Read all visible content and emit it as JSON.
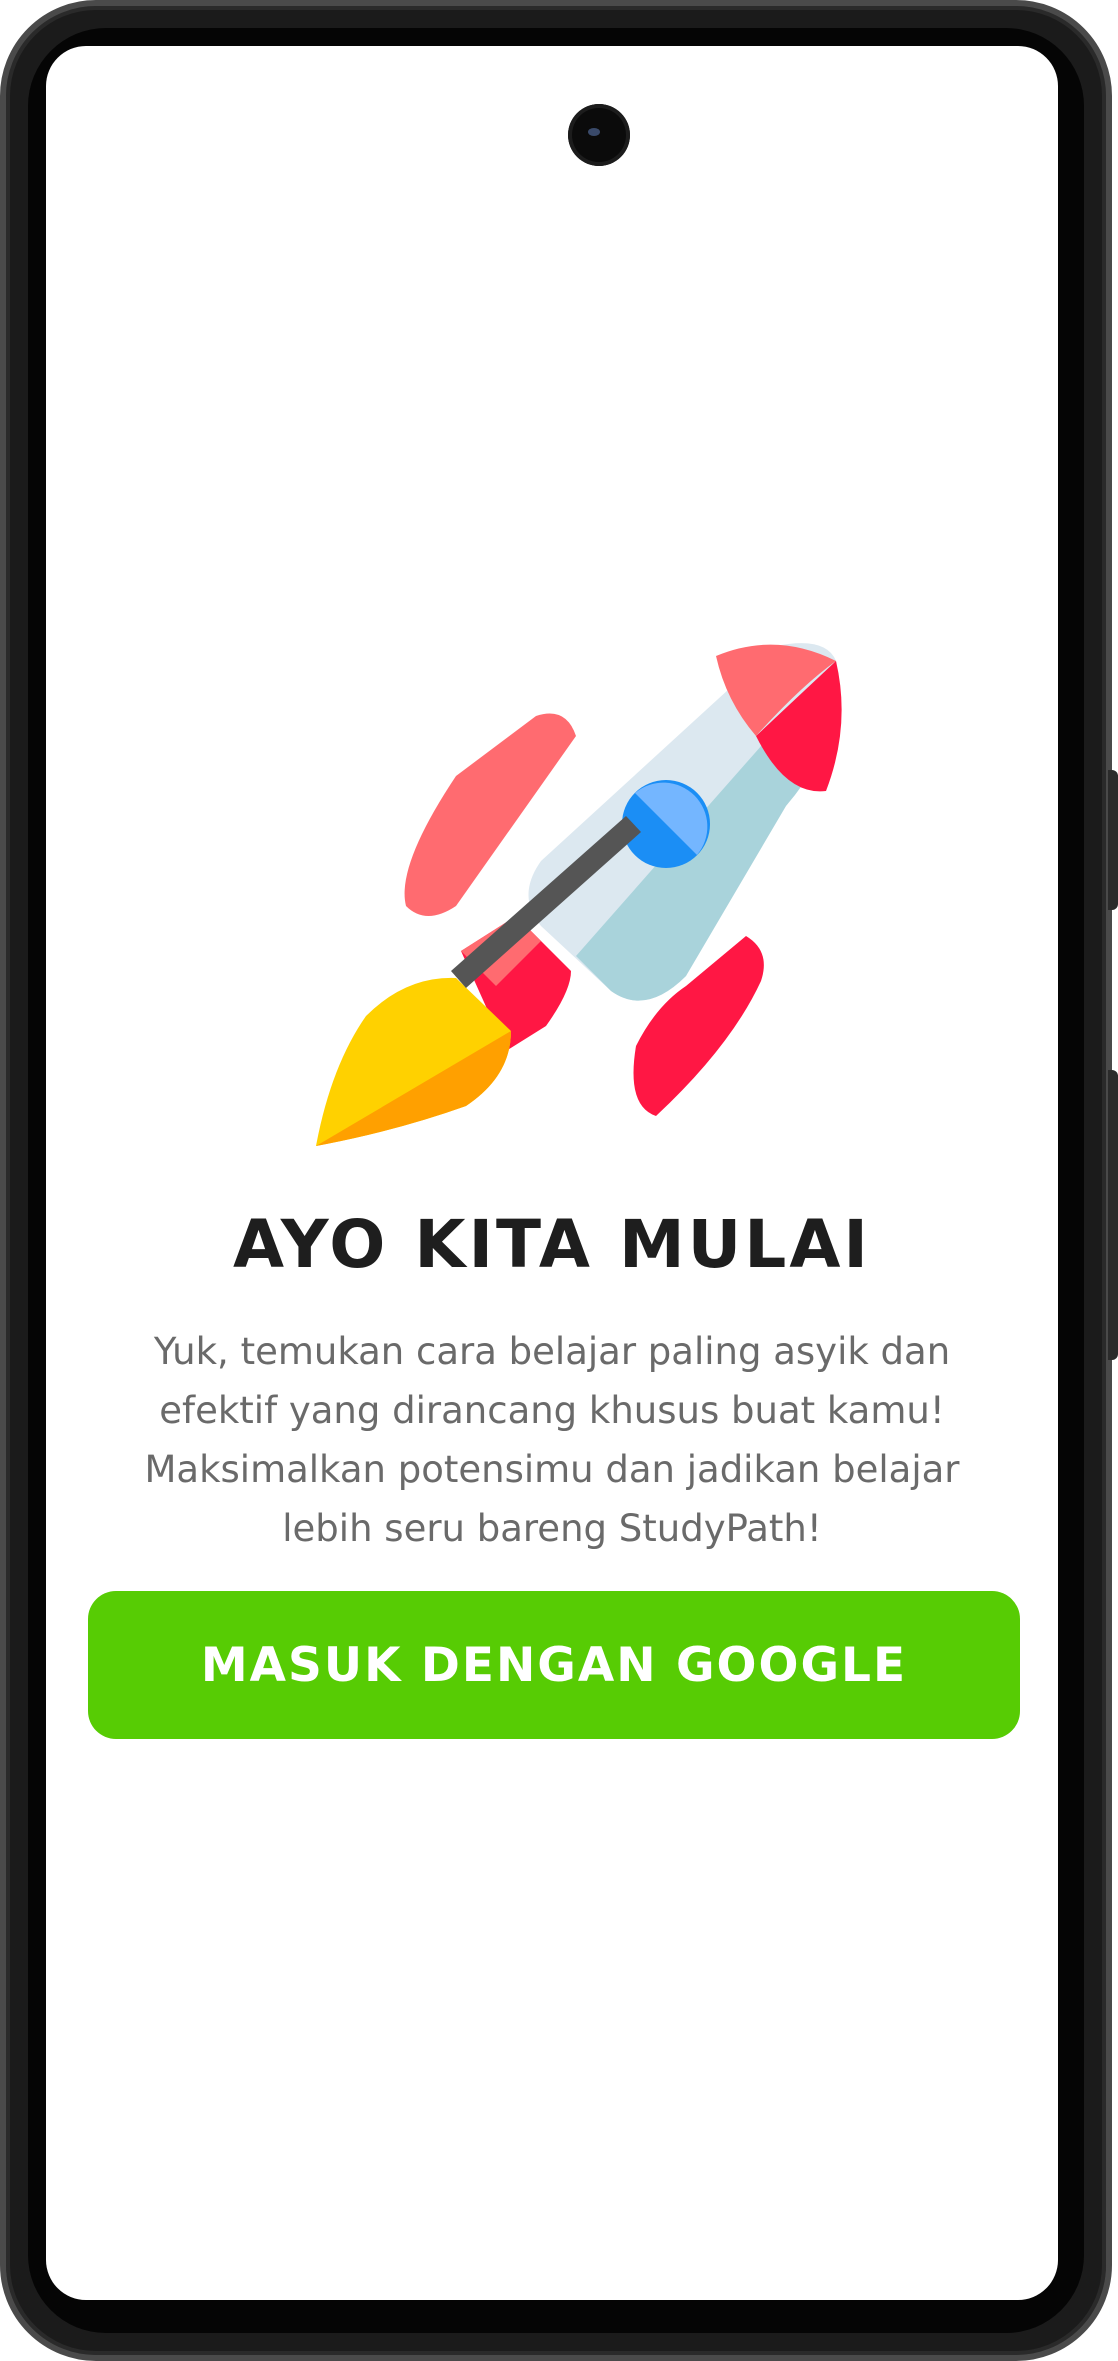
{
  "colors": {
    "accent": "#57CC04",
    "title": "#1E1E1E",
    "body_text": "#6A6A6A",
    "rocket_body": "#DCE8F0",
    "rocket_shade": "#A9D3DB",
    "rocket_red": "#FF1744",
    "rocket_pink": "#FF6B70",
    "window": "#1B8EF5",
    "flame_yellow": "#FFD100",
    "flame_orange": "#FFA000"
  },
  "hero": {
    "illustration": "rocket-icon"
  },
  "onboarding": {
    "title": "AYO KITA MULAI",
    "description": "Yuk, temukan cara belajar paling asyik dan\nefektif yang dirancang khusus buat kamu!\nMaksimalkan potensimu dan jadikan belajar\nlebih seru bareng StudyPath!",
    "login_button_label": "MASUK DENGAN GOOGLE"
  }
}
